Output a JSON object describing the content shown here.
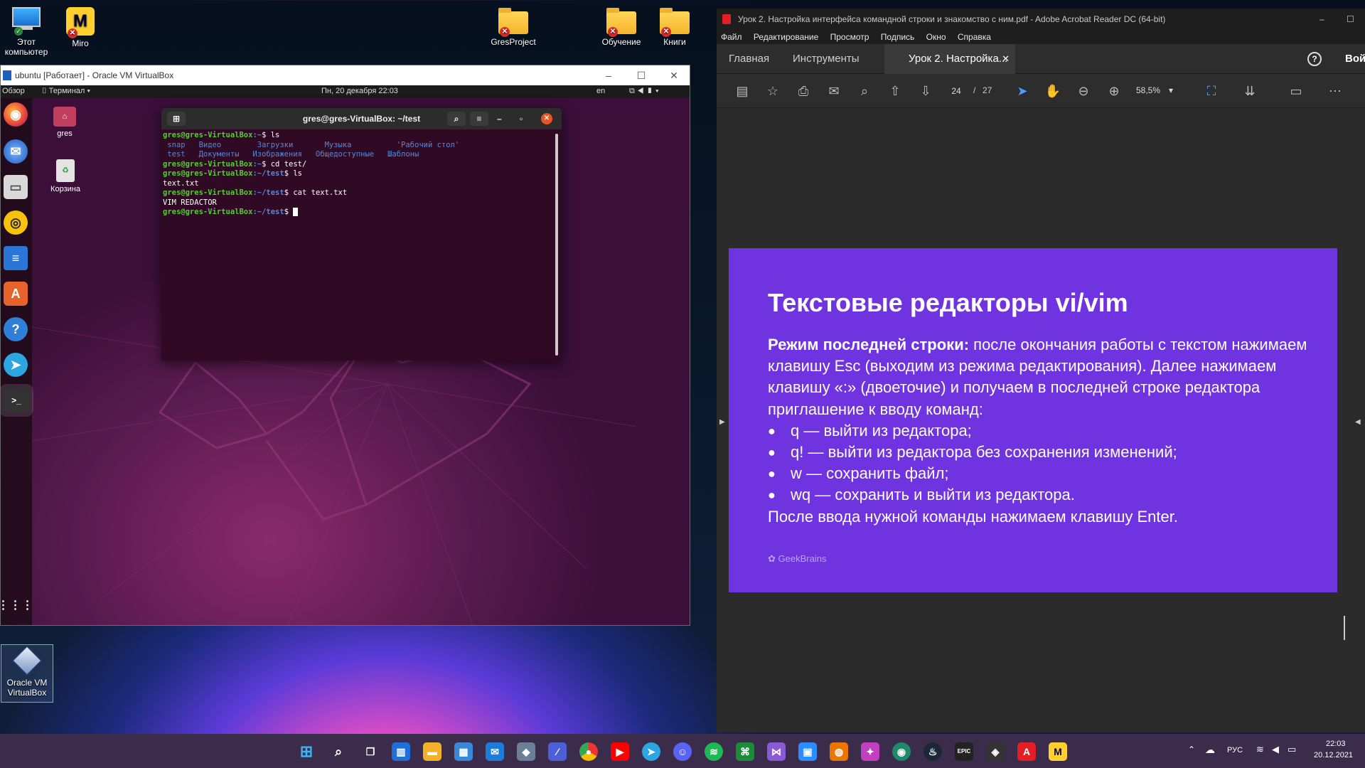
{
  "desktop": {
    "icons": [
      {
        "label": "Этот компьютер"
      },
      {
        "label": "Miro"
      },
      {
        "label": "GresProject"
      },
      {
        "label": "Обучение"
      },
      {
        "label": "Книги"
      },
      {
        "label": "Oracle VM VirtualBox"
      }
    ]
  },
  "virtualbox": {
    "title": "ubuntu [Работает] - Oracle VM VirtualBox",
    "topbar": {
      "overview": "Обзор",
      "app_menu": "Терминал",
      "datetime": "Пн, 20 декабря  22:03",
      "lang": "en"
    },
    "desktop_icons": [
      {
        "label": "gres"
      },
      {
        "label": "Корзина"
      }
    ],
    "terminal": {
      "title": "gres@gres-VirtualBox: ~/test",
      "prompt_home": "gres@gres-VirtualBox",
      "lines": {
        "l1_path": ":~",
        "l1_cmd": "$ ls",
        "l2": " snap   Видео        Загрузки       Музыка          'Рабочий стол'",
        "l3": " test   Документы   Изображения   Общедоступные   Шаблоны",
        "l4_path": ":~",
        "l4_cmd": "$ cd test/",
        "l5_path": ":~/test",
        "l5_cmd": "$ ls",
        "l6": "text.txt",
        "l7_path": ":~/test",
        "l7_cmd": "$ cat text.txt",
        "l8": "VIM REDACTOR",
        "l9_path": ":~/test",
        "l9_cmd": "$ "
      }
    }
  },
  "acrobat": {
    "title": "Урок 2. Настройка интерфейса командной строки и знакомство с ним.pdf - Adobe Acrobat Reader DC (64-bit)",
    "menu": [
      "Файл",
      "Редактирование",
      "Просмотр",
      "Подпись",
      "Окно",
      "Справка"
    ],
    "tabs": {
      "home": "Главная",
      "tools": "Инструменты",
      "doc": "Урок 2. Настройка...",
      "login": "Вой"
    },
    "page_current": "24",
    "page_sep": "/",
    "page_total": "27",
    "zoom": "58,5%",
    "slide": {
      "title": "Текстовые редакторы vi/vim",
      "lead_bold": "Режим последней строки:",
      "lead_text": " после окончания работы с текстом нажимаем клавишу Esc (выходим из режима редактирования). Далее нажимаем клавишу «:» (двоеточие) и получаем в последней строке редактора приглашение к вводу команд:",
      "bullets": [
        "q — выйти из редактора;",
        "q! — выйти из редактора без сохранения изменений;",
        "w — сохранить файл;",
        "wq — сохранить и выйти из редактора."
      ],
      "footer_text": " После ввода нужной команды нажимаем клавишу Enter.",
      "brand": "GeekBrains"
    }
  },
  "taskbar": {
    "lang": "РУС",
    "time": "22:03",
    "date": "20.12.2021"
  },
  "colors": {
    "slide_bg": "#6f33e0",
    "ubuntu_bg": "#3b0f3a",
    "terminal_bg": "#300a24"
  }
}
